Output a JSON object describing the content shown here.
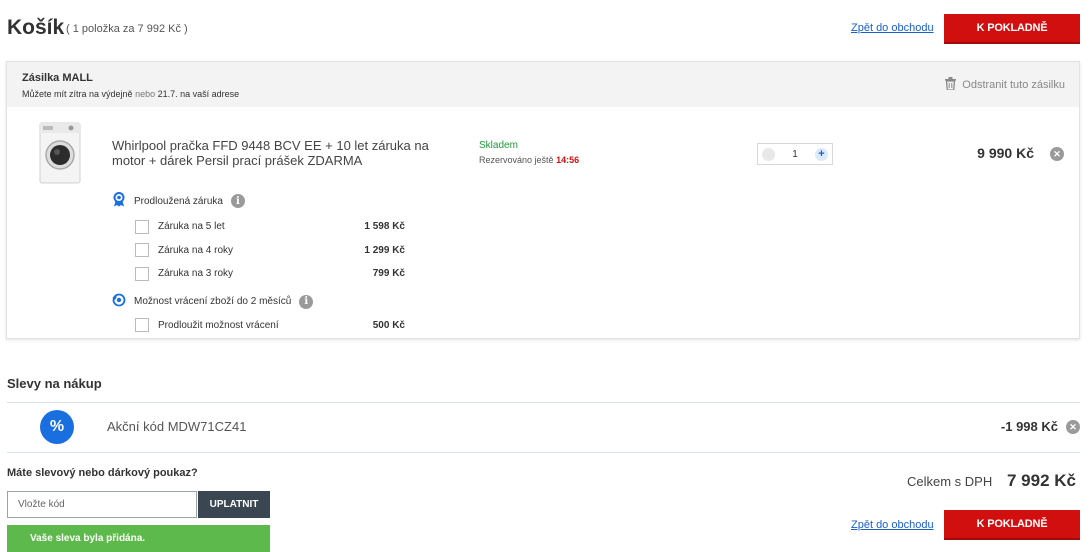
{
  "header": {
    "title": "Košík",
    "subtitle": "( 1 položka za 7 992 Kč )",
    "back_link": "Zpět do obchodu",
    "checkout_button": "K POKLADNĚ"
  },
  "shipment": {
    "title": "Zásilka MALL",
    "delivery_prefix": "Můžete mít zítra na výdejně",
    "delivery_or": "nebo",
    "delivery_suffix": "21.7. na vaší adrese",
    "remove_label": "Odstranit tuto zásilku"
  },
  "product": {
    "name": "Whirlpool pračka FFD 9448 BCV EE + 10 let záruka na motor + dárek Persil prací prášek ZDARMA",
    "stock": "Skladem",
    "reserved_label": "Rezervováno ještě",
    "reserved_time": "14:56",
    "quantity": "1",
    "price": "9 990 Kč"
  },
  "warranty": {
    "title": "Prodloužená záruka",
    "options": [
      {
        "label": "Záruka na 5 let",
        "price": "1 598 Kč"
      },
      {
        "label": "Záruka na 4 roky",
        "price": "1 299 Kč"
      },
      {
        "label": "Záruka na 3 roky",
        "price": "799 Kč"
      }
    ]
  },
  "returns": {
    "title": "Možnost vrácení zboží do 2 měsíců",
    "options": [
      {
        "label": "Prodloužit možnost vrácení",
        "price": "500 Kč"
      }
    ]
  },
  "discounts": {
    "title": "Slevy na nákup",
    "icon_text": "%",
    "code_label": "Akční kód MDW71CZ41",
    "amount": "-1 998 Kč"
  },
  "voucher": {
    "question": "Máte slevový nebo dárkový poukaz?",
    "placeholder": "Vložte kód",
    "apply_button": "UPLATNIT",
    "success_message": "Vaše sleva byla přidána."
  },
  "summary": {
    "total_label": "Celkem s DPH",
    "total_value": "7 992 Kč",
    "back_link": "Zpět do obchodu",
    "checkout_button": "K POKLADNĚ"
  },
  "colors": {
    "primary_red": "#d10f0f",
    "link_blue": "#1a5fc8",
    "success_green": "#5db94b",
    "stock_green": "#1f9a3a"
  }
}
